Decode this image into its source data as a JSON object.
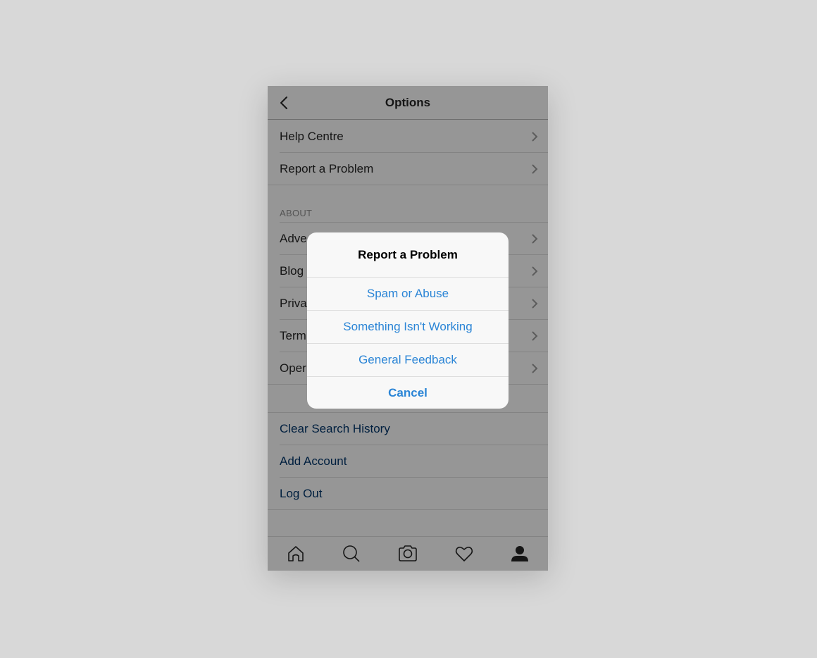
{
  "header": {
    "title": "Options",
    "back_icon": "chevron-left-icon"
  },
  "support": {
    "items": [
      {
        "label": "Help Centre",
        "icon": "chevron-right-icon"
      },
      {
        "label": "Report a Problem",
        "icon": "chevron-right-icon"
      }
    ]
  },
  "about": {
    "header": "ABOUT",
    "items": [
      {
        "label": "Adve",
        "icon": "chevron-right-icon"
      },
      {
        "label": "Blog",
        "icon": "chevron-right-icon"
      },
      {
        "label": "Priva",
        "icon": "chevron-right-icon"
      },
      {
        "label": "Term",
        "icon": "chevron-right-icon"
      },
      {
        "label": "Oper",
        "icon": "chevron-right-icon"
      }
    ]
  },
  "account": {
    "items": [
      {
        "label": "Clear Search History"
      },
      {
        "label": "Add Account"
      },
      {
        "label": "Log Out"
      }
    ]
  },
  "tabbar": {
    "tabs": [
      {
        "name": "home",
        "icon": "home-icon"
      },
      {
        "name": "search",
        "icon": "search-icon"
      },
      {
        "name": "camera",
        "icon": "camera-icon"
      },
      {
        "name": "activity",
        "icon": "heart-icon"
      },
      {
        "name": "profile",
        "icon": "profile-icon",
        "active": true
      }
    ]
  },
  "alert": {
    "title": "Report a Problem",
    "actions": [
      {
        "label": "Spam or Abuse"
      },
      {
        "label": "Something Isn't Working"
      },
      {
        "label": "General Feedback"
      },
      {
        "label": "Cancel",
        "style": "cancel"
      }
    ]
  },
  "colors": {
    "accent": "#2b85d6",
    "link_dark": "#003569",
    "overlay": "rgba(0,0,0,0.4)"
  }
}
